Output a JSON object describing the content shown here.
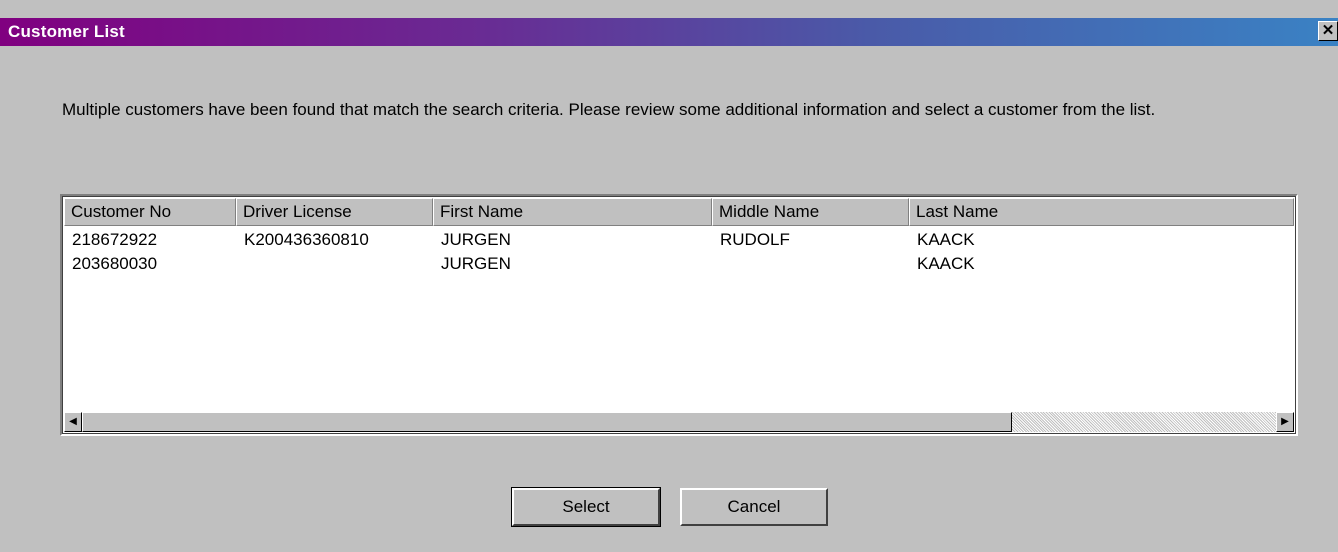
{
  "window": {
    "title": "Customer List",
    "close_glyph": "✕"
  },
  "message": "Multiple customers have been found that match the search criteria. Please review some additional information and select a customer from the list.",
  "list": {
    "columns": [
      "Customer No",
      "Driver License",
      "First Name",
      "Middle Name",
      "Last Name"
    ],
    "rows": [
      [
        "218672922",
        "K200436360810",
        "JURGEN",
        "RUDOLF",
        "KAACK"
      ],
      [
        "203680030",
        "",
        "JURGEN",
        "",
        "KAACK"
      ]
    ]
  },
  "scrollbar": {
    "left_arrow": "◀",
    "right_arrow": "▶"
  },
  "buttons": {
    "select_label": "Select",
    "cancel_label": "Cancel"
  }
}
